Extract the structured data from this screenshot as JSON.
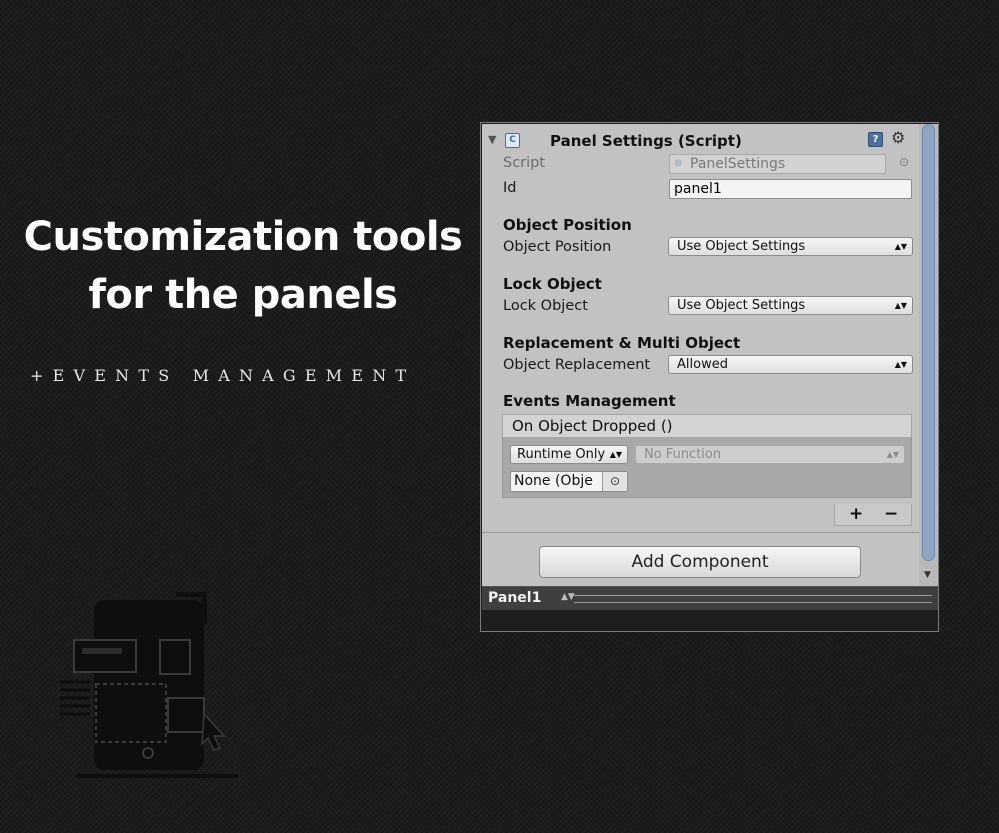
{
  "headline": {
    "line1": "Customization tools",
    "line2": "for the panels",
    "subline": "+EVENTS MANAGEMENT"
  },
  "inspector": {
    "component_title": "Panel Settings (Script)",
    "fields": {
      "script_label": "Script",
      "script_value": "PanelSettings",
      "id_label": "Id",
      "id_value": "panel1"
    },
    "sections": {
      "object_position": {
        "header": "Object Position",
        "label": "Object Position",
        "value": "Use Object Settings"
      },
      "lock_object": {
        "header": "Lock Object",
        "label": "Lock Object",
        "value": "Use Object Settings"
      },
      "replacement": {
        "header": "Replacement & Multi Object",
        "label": "Object Replacement",
        "value": "Allowed"
      },
      "events": {
        "header": "Events Management",
        "event_name": "On Object Dropped ()",
        "runtime_value": "Runtime Only",
        "function_value": "No Function",
        "object_value": "None (Obje",
        "plus": "+",
        "minus": "−"
      }
    },
    "add_component": "Add Component",
    "bottom_tab": "Panel1"
  },
  "icons": {
    "foldout": "triangle-down-icon",
    "script": "cs-script-icon",
    "help": "help-book-icon",
    "settings": "gear-icon",
    "object_picker": "object-picker-icon",
    "illustration": "mobile-app-editing-icon"
  },
  "colors": {
    "background": "#1c1c1c",
    "inspector_panel": "#c2c2c2",
    "scroll_thumb": "#8fa5c5",
    "bottom_bar": "#3f3f3f"
  }
}
